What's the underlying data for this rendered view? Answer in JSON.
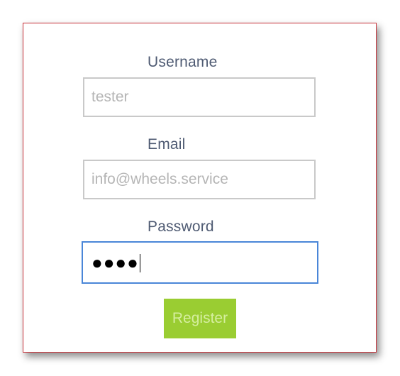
{
  "form": {
    "username": {
      "label": "Username",
      "placeholder": "tester",
      "value": ""
    },
    "email": {
      "label": "Email",
      "placeholder": "info@wheels.service",
      "value": ""
    },
    "password": {
      "label": "Password",
      "masked_value": "●●●●"
    },
    "register_label": "Register"
  },
  "colors": {
    "card_border": "#c8323a",
    "label_text": "#4f5b73",
    "field_border": "#c9c9c9",
    "focus_border": "#4a86d8",
    "button_bg": "#9acd32",
    "button_text": "#d5ee9f"
  }
}
